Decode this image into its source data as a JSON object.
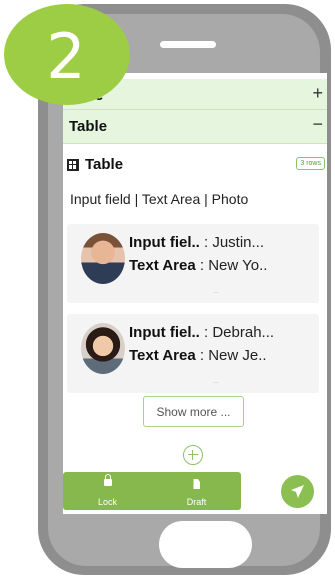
{
  "step_number": "2",
  "sections": {
    "row1": {
      "label": "ence",
      "sign": "+"
    },
    "row2": {
      "label": "Table",
      "sign": "−"
    }
  },
  "table": {
    "title": "Table",
    "rows_badge": "3 rows",
    "columns": "Input field | Text Area | Photo"
  },
  "records": [
    {
      "input_label": "Input fiel..",
      "input_value": ": Justin...",
      "text_label": "Text Area",
      "text_value": ": New Yo..",
      "dots": "..."
    },
    {
      "input_label": "Input fiel..",
      "input_value": ": Debrah...",
      "text_label": "Text Area",
      "text_value": ": New Je..",
      "dots": "..."
    }
  ],
  "show_more_label": "Show more ...",
  "bottom_bar": {
    "lock_label": "Lock",
    "draft_label": "Draft"
  },
  "colors": {
    "accent": "#86b84e",
    "section_bg": "#e6f5de",
    "badge": "#9ccd45"
  },
  "icons": [
    "grid-icon",
    "plus-icon",
    "lock-icon",
    "draft-icon",
    "send-icon"
  ]
}
